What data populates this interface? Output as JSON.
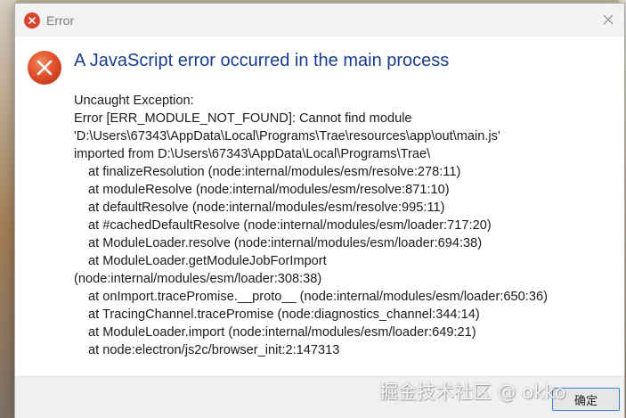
{
  "window": {
    "title": "Error",
    "close_icon": "close-icon",
    "title_icon": "error-icon"
  },
  "dialog": {
    "icon": "error-circle-icon",
    "heading": "A JavaScript error occurred in the main process",
    "message_lines": [
      "Uncaught Exception:",
      "Error [ERR_MODULE_NOT_FOUND]: Cannot find module",
      "'D:\\Users\\67343\\AppData\\Local\\Programs\\Trae\\resources\\app\\out\\main.js'",
      "imported from D:\\Users\\67343\\AppData\\Local\\Programs\\Trae\\",
      "at finalizeResolution (node:internal/modules/esm/resolve:278:11)",
      "at moduleResolve (node:internal/modules/esm/resolve:871:10)",
      "at defaultResolve (node:internal/modules/esm/resolve:995:11)",
      "at #cachedDefaultResolve (node:internal/modules/esm/loader:717:20)",
      "at ModuleLoader.resolve (node:internal/modules/esm/loader:694:38)",
      "at ModuleLoader.getModuleJobForImport",
      "(node:internal/modules/esm/loader:308:38)",
      "at onImport.tracePromise.__proto__ (node:internal/modules/esm/loader:650:36)",
      "at TracingChannel.tracePromise (node:diagnostics_channel:344:14)",
      "at ModuleLoader.import (node:internal/modules/esm/loader:649:21)",
      "at node:electron/js2c/browser_init:2:147313"
    ],
    "ok_button_label": "确定"
  },
  "watermark": "掘金技术社区 @ okko",
  "colors": {
    "heading": "#1a3d8f",
    "error_red": "#d8432a",
    "button_border": "#3c7fd8"
  }
}
